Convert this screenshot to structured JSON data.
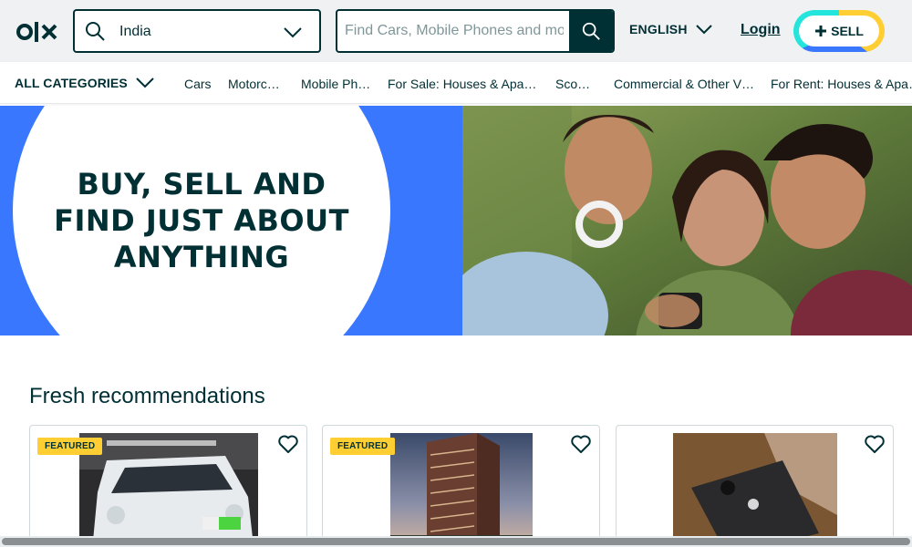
{
  "header": {
    "logo_alt": "OLX",
    "location_value": "India",
    "search_placeholder": "Find Cars, Mobile Phones and more...",
    "language": "ENGLISH",
    "login": "Login",
    "sell": "SELL"
  },
  "categories": {
    "all_label": "ALL CATEGORIES",
    "items": [
      "Cars",
      "Motorc…",
      "Mobile Ph…",
      "For Sale: Houses & Apa…",
      "Sco…",
      "Commercial & Other V…",
      "For Rent: Houses & Apa…"
    ]
  },
  "banner": {
    "line1": "BUY, SELL AND",
    "line2": "FIND JUST ABOUT",
    "line3": "ANYTHING"
  },
  "recommendations": {
    "title": "Fresh recommendations",
    "cards": [
      {
        "badge": "FEATURED",
        "image": "white-car-photo"
      },
      {
        "badge": "FEATURED",
        "image": "apartment-building-photo"
      },
      {
        "badge": "",
        "image": "iphone-box-photo"
      }
    ]
  },
  "colors": {
    "brand_dark": "#002f34",
    "banner_blue": "#3a77ff",
    "featured_yellow": "#ffce32",
    "sell_teal": "#23e5db"
  }
}
